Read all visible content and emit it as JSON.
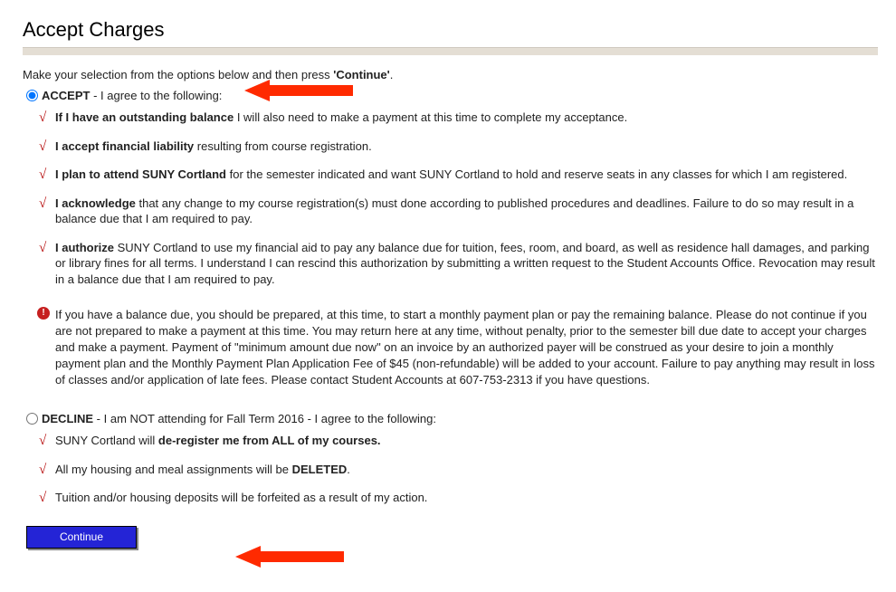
{
  "page_title": "Accept Charges",
  "instruction_prefix": "Make your selection from the options below and then press ",
  "instruction_bold": "'Continue'",
  "instruction_suffix": ".",
  "accept": {
    "label_bold": "ACCEPT",
    "label_rest": " - I agree to the following:",
    "items": [
      {
        "lead": "If I have an outstanding balance",
        "rest": " I will also need to make a payment at this time to complete my acceptance."
      },
      {
        "lead": "I accept financial liability",
        "rest": " resulting from course registration."
      },
      {
        "lead": "I plan to attend SUNY Cortland",
        "rest": " for the semester indicated and want SUNY Cortland to hold and reserve seats in any classes for which I am registered."
      },
      {
        "lead": "I acknowledge",
        "rest": " that any change to my course registration(s) must done according to published procedures and deadlines. Failure to do so may result in a balance due that I am required to pay."
      },
      {
        "lead": "I authorize",
        "rest": " SUNY Cortland to use my financial aid to pay any balance due for tuition, fees, room, and board, as well as residence hall damages, and parking or library fines for all terms. I understand I can rescind this authorization by submitting a written request to the Student Accounts Office. Revocation may result in a balance due that I am required to pay."
      }
    ],
    "notice": "If you have a balance due, you should be prepared, at this time, to start a monthly payment plan or pay the remaining balance. Please do not continue if you are not prepared to make a payment at this time. You may return here at any time, without penalty, prior to the semester bill due date to accept your charges and make a payment. Payment of \"minimum amount due now\" on an invoice by an authorized payer will be construed as your desire to join a monthly payment plan and the Monthly Payment Plan Application Fee of $45 (non-refundable) will be added to your account. Failure to pay anything may result in loss of classes and/or application of late fees. Please contact Student Accounts at 607-753-2313 if you have questions."
  },
  "decline": {
    "label_bold": "DECLINE",
    "label_rest": " - I am NOT attending for Fall Term 2016 - I agree to the following:",
    "items": [
      {
        "pre": "SUNY Cortland will ",
        "bold": "de-register me from ALL of my courses.",
        "post": ""
      },
      {
        "pre": "All my housing and meal assignments will be ",
        "bold": "DELETED",
        "post": "."
      },
      {
        "pre": "Tuition and/or housing deposits will be forfeited as a result of my action.",
        "bold": "",
        "post": ""
      }
    ]
  },
  "continue_label": "Continue"
}
